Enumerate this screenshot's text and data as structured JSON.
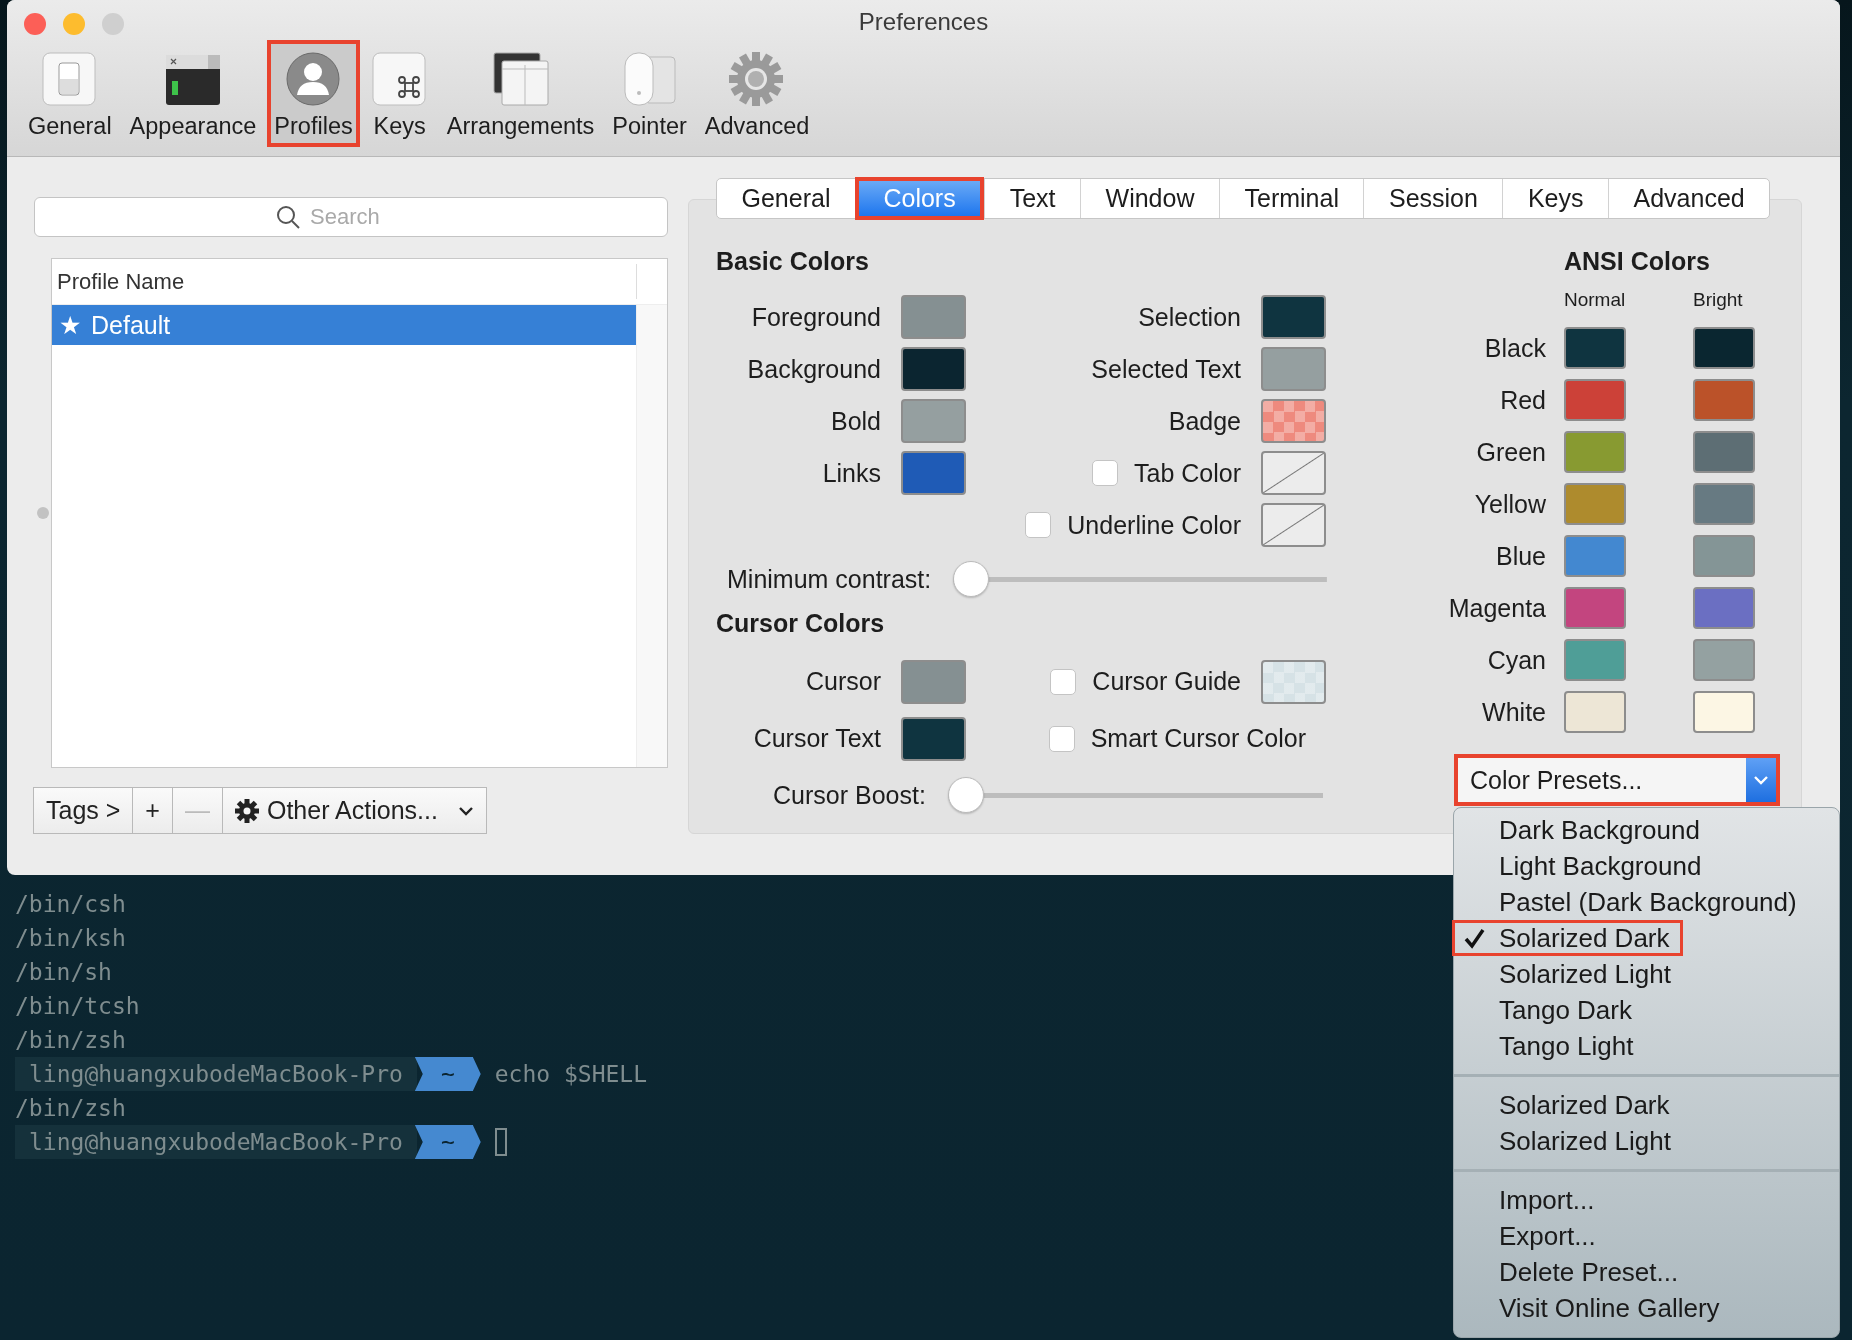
{
  "window": {
    "title": "Preferences"
  },
  "toolbar": [
    {
      "label": "General",
      "selected": false,
      "highlighted": false
    },
    {
      "label": "Appearance",
      "selected": false,
      "highlighted": false
    },
    {
      "label": "Profiles",
      "selected": true,
      "highlighted": true
    },
    {
      "label": "Keys",
      "selected": false,
      "highlighted": false
    },
    {
      "label": "Arrangements",
      "selected": false,
      "highlighted": false
    },
    {
      "label": "Pointer",
      "selected": false,
      "highlighted": false
    },
    {
      "label": "Advanced",
      "selected": false,
      "highlighted": false
    }
  ],
  "profiles": {
    "search": {
      "placeholder": "Search"
    },
    "column": "Profile Name",
    "rows": [
      {
        "marker": "★",
        "name": "Default",
        "selected": true
      }
    ],
    "buttons": [
      {
        "label": "Tags >",
        "kind": "text",
        "disabled": false
      },
      {
        "label": "+",
        "kind": "text",
        "disabled": false
      },
      {
        "label": "—",
        "kind": "text",
        "disabled": true
      },
      {
        "label": "Other Actions...",
        "kind": "menu",
        "disabled": false
      }
    ]
  },
  "tabs": [
    {
      "label": "General",
      "selected": false,
      "highlighted": false
    },
    {
      "label": "Colors",
      "selected": true,
      "highlighted": true
    },
    {
      "label": "Text",
      "selected": false,
      "highlighted": false
    },
    {
      "label": "Window",
      "selected": false,
      "highlighted": false
    },
    {
      "label": "Terminal",
      "selected": false,
      "highlighted": false
    },
    {
      "label": "Session",
      "selected": false,
      "highlighted": false
    },
    {
      "label": "Keys",
      "selected": false,
      "highlighted": false
    },
    {
      "label": "Advanced",
      "selected": false,
      "highlighted": false
    }
  ],
  "basic_colors": {
    "title": "Basic Colors",
    "left": [
      {
        "label": "Foreground",
        "kind": "solid",
        "color": "#859092"
      },
      {
        "label": "Background",
        "kind": "solid",
        "color": "#0b2530"
      },
      {
        "label": "Bold",
        "kind": "solid",
        "color": "#959fa0"
      },
      {
        "label": "Links",
        "kind": "solid",
        "color": "#1f5bb6"
      }
    ],
    "right": [
      {
        "label": "Selection",
        "kind": "solid",
        "color": "#0f3440"
      },
      {
        "label": "Selected Text",
        "kind": "solid",
        "color": "#959fa0"
      },
      {
        "label": "Badge",
        "kind": "checker",
        "color": "#ee8a7e"
      },
      {
        "label": "Tab Color",
        "kind": "none",
        "checked": false
      },
      {
        "label": "Underline Color",
        "kind": "none",
        "checked": false
      }
    ],
    "minimum_contrast": {
      "label": "Minimum contrast:",
      "level": 0
    }
  },
  "cursor_colors": {
    "title": "Cursor Colors",
    "left": [
      {
        "label": "Cursor",
        "kind": "solid",
        "color": "#859092"
      },
      {
        "label": "Cursor Text",
        "kind": "solid",
        "color": "#0f3440"
      }
    ],
    "right": [
      {
        "label": "Cursor Guide",
        "kind": "checker",
        "color": "#d6e2e6",
        "checked": false
      },
      {
        "label": "Smart Cursor Color",
        "kind": "empty",
        "checked": false
      }
    ],
    "cursor_boost": {
      "label": "Cursor Boost:",
      "level": 0
    }
  },
  "ansi_colors": {
    "title": "ANSI Colors",
    "columns": [
      "Normal",
      "Bright"
    ],
    "rows": [
      {
        "name": "Black",
        "normal": {
          "color": "#0f3440"
        },
        "bright": {
          "color": "#0a2630"
        }
      },
      {
        "name": "Red",
        "normal": {
          "color": "#cc4138"
        },
        "bright": {
          "color": "#bb5229"
        }
      },
      {
        "name": "Green",
        "normal": {
          "color": "#889a31"
        },
        "bright": {
          "color": "#5d6e74"
        }
      },
      {
        "name": "Yellow",
        "normal": {
          "color": "#ae8b2d"
        },
        "bright": {
          "color": "#677a82"
        }
      },
      {
        "name": "Blue",
        "normal": {
          "color": "#4388d0"
        },
        "bright": {
          "color": "#849596"
        }
      },
      {
        "name": "Magenta",
        "normal": {
          "color": "#c3457f"
        },
        "bright": {
          "color": "#6b6fc2"
        }
      },
      {
        "name": "Cyan",
        "normal": {
          "color": "#4f9e97"
        },
        "bright": {
          "color": "#94a1a1"
        }
      },
      {
        "name": "White",
        "normal": {
          "color": "#ede6d6"
        },
        "bright": {
          "color": "#fcf6e4"
        }
      }
    ]
  },
  "color_presets": {
    "label": "Color Presets...",
    "highlighted": true,
    "menu": [
      {
        "items": [
          {
            "label": "Dark Background",
            "checked": false,
            "highlighted": false
          },
          {
            "label": "Light Background",
            "checked": false,
            "highlighted": false
          },
          {
            "label": "Pastel (Dark Background)",
            "checked": false,
            "highlighted": false
          },
          {
            "label": "Solarized Dark",
            "checked": true,
            "highlighted": true
          },
          {
            "label": "Solarized Light",
            "checked": false,
            "highlighted": false
          },
          {
            "label": "Tango Dark",
            "checked": false,
            "highlighted": false
          },
          {
            "label": "Tango Light",
            "checked": false,
            "highlighted": false
          }
        ]
      },
      {
        "items": [
          {
            "label": "Solarized Dark",
            "checked": false,
            "highlighted": false
          },
          {
            "label": "Solarized Light",
            "checked": false,
            "highlighted": false
          }
        ]
      },
      {
        "items": [
          {
            "label": "Import...",
            "checked": false,
            "highlighted": false
          },
          {
            "label": "Export...",
            "checked": false,
            "highlighted": false
          },
          {
            "label": "Delete Preset...",
            "checked": false,
            "highlighted": false
          },
          {
            "label": "Visit Online Gallery",
            "checked": false,
            "highlighted": false
          }
        ]
      }
    ]
  },
  "terminal": {
    "lines": [
      {
        "kind": "output",
        "text": "/bin/csh"
      },
      {
        "kind": "output",
        "text": "/bin/ksh"
      },
      {
        "kind": "output",
        "text": "/bin/sh"
      },
      {
        "kind": "output",
        "text": "/bin/tcsh"
      },
      {
        "kind": "output",
        "text": "/bin/zsh"
      },
      {
        "kind": "prompt",
        "user": "ling@huangxubodeMacBook-Pro",
        "dir": "~",
        "command": "echo $SHELL"
      },
      {
        "kind": "output",
        "text": "/bin/zsh"
      },
      {
        "kind": "prompt",
        "user": "ling@huangxubodeMacBook-Pro",
        "dir": "~"
      }
    ]
  }
}
